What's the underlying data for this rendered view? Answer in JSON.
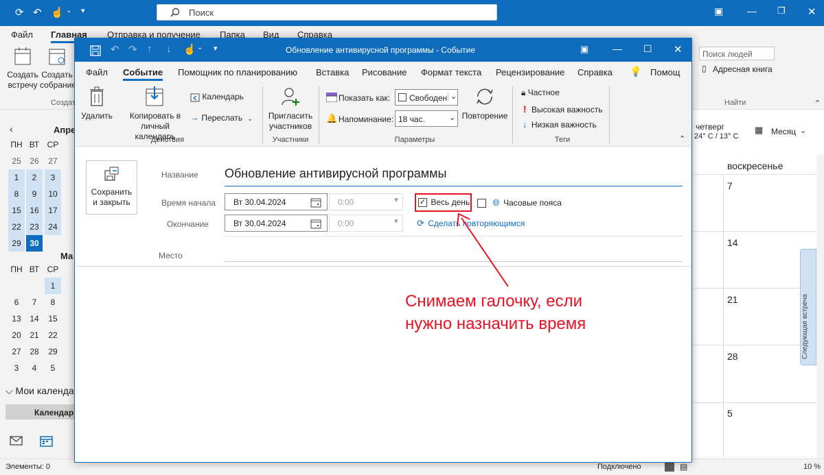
{
  "outlook": {
    "search_placeholder": "Поиск",
    "menu": [
      "Файл",
      "Главная",
      "Отправка и получение",
      "Папка",
      "Вид",
      "Справка"
    ],
    "ribbon_new_meeting": "Создать встречу",
    "ribbon_new_meeting_l1": "Создать",
    "ribbon_new_meeting_l2": "встречу",
    "ribbon_new_gathering_l1": "Создать",
    "ribbon_new_gathering_l2": "собрание",
    "ribbon_group_create": "Создат",
    "people_search_placeholder": "Поиск людей",
    "address_book": "Адресная книга",
    "group_find": "Найти",
    "weather_day": "четверг",
    "weather_temp": "24° C / 13° C",
    "view_month": "Месяц",
    "col_sunday": "воскресенье",
    "sunday_dates": [
      "7",
      "14",
      "21",
      "28",
      "5"
    ],
    "next_meeting_label": "Следующая встреча",
    "status_items": "Элементы: 0",
    "status_connected": "Подключено",
    "zoom": "10 %"
  },
  "mini_calendar": {
    "month1": "Апре",
    "month2": "Ма",
    "weekdays": [
      "ПН",
      "ВТ",
      "СР"
    ],
    "month1_rows": [
      [
        "25",
        "26",
        "27"
      ],
      [
        "1",
        "2",
        "3"
      ],
      [
        "8",
        "9",
        "10"
      ],
      [
        "15",
        "16",
        "17"
      ],
      [
        "22",
        "23",
        "24"
      ],
      [
        "29",
        "30",
        ""
      ]
    ],
    "month2_rows": [
      [
        "",
        "",
        "1"
      ],
      [
        "6",
        "7",
        "8"
      ],
      [
        "13",
        "14",
        "15"
      ],
      [
        "20",
        "21",
        "22"
      ],
      [
        "27",
        "28",
        "29"
      ],
      [
        "3",
        "4",
        "5"
      ]
    ],
    "my_calendars": "Мои календа",
    "calendars_item": "Календарь"
  },
  "dialog": {
    "title": "Обновление антивирусной программы  -  Событие",
    "tabs": [
      "Файл",
      "Событие",
      "Помощник по планированию",
      "Вставка",
      "Рисование",
      "Формат текста",
      "Рецензирование",
      "Справка",
      "Помощ"
    ],
    "delete_label": "Удалить",
    "copy_label_l1": "Копировать в",
    "copy_label_l2": "личный календарь",
    "calendar_label": "Календарь",
    "forward_label": "Переслать",
    "group_actions": "Действия",
    "invite_l1": "Пригласить",
    "invite_l2": "участников",
    "group_attendees": "Участники",
    "show_as_label": "Показать как:",
    "show_as_value": "Свободен",
    "reminder_label": "Напоминание:",
    "reminder_value": "18 час.",
    "recurrence_label": "Повторение",
    "group_options": "Параметры",
    "private_label": "Частное",
    "high_importance": "Высокая важность",
    "low_importance": "Низкая важность",
    "group_tags": "Теги",
    "save_close_l1": "Сохранить",
    "save_close_l2": "и закрыть",
    "subject_label": "Название",
    "subject_value": "Обновление антивирусной программы",
    "start_label": "Время начала",
    "start_date": "Вт 30.04.2024",
    "start_time": "0:00",
    "end_label": "Окончание",
    "end_date": "Вт 30.04.2024",
    "end_time": "0:00",
    "all_day_label": "Весь день",
    "all_day_checked": true,
    "timezones_label": "Часовые пояса",
    "make_recurring": "Сделать повторяющимся",
    "location_label": "Место"
  },
  "annotation": {
    "line1": "Снимаем галочку, если",
    "line2": "нужно назначить время",
    "color": "#e81123"
  }
}
